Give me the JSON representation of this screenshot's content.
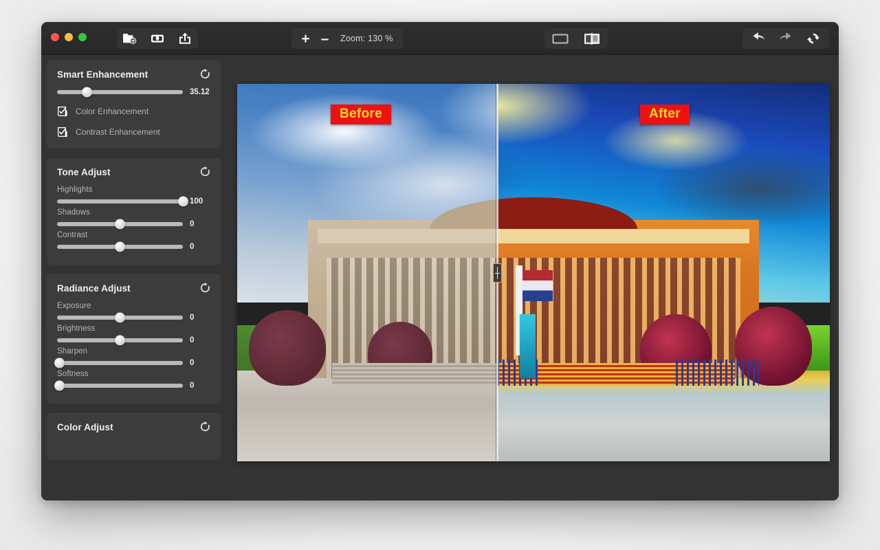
{
  "window": {
    "traffic_lights": [
      "close",
      "minimize",
      "zoom"
    ],
    "colors": {
      "close": "#fc5754",
      "minimize": "#fdbc40",
      "zoom": "#34c748",
      "accent": "#ee1111",
      "tag_text": "#ffdd22"
    }
  },
  "toolbar": {
    "open_label": "Open",
    "save_label": "Save",
    "share_label": "Share",
    "zoom_in_label": "+",
    "zoom_out_label": "–",
    "zoom_text": "Zoom: 130 %",
    "view_single_label": "Single View",
    "view_split_label": "Split View",
    "undo_label": "Undo",
    "redo_label": "Redo",
    "reset_label": "Reset All"
  },
  "sidebar": {
    "panels": [
      {
        "title": "Smart Enhancement",
        "reset_label": "Reset",
        "sliders": [
          {
            "label": "",
            "value": "35.12",
            "percent": 24
          }
        ],
        "checkboxes": [
          {
            "label": "Color Enhancement",
            "checked": true
          },
          {
            "label": "Contrast Enhancement",
            "checked": true
          }
        ]
      },
      {
        "title": "Tone Adjust",
        "reset_label": "Reset",
        "sliders": [
          {
            "label": "Highlights",
            "value": "100",
            "percent": 100
          },
          {
            "label": "Shadows",
            "value": "0",
            "percent": 50
          },
          {
            "label": "Contrast",
            "value": "0",
            "percent": 50
          }
        ],
        "checkboxes": []
      },
      {
        "title": "Radiance Adjust",
        "reset_label": "Reset",
        "sliders": [
          {
            "label": "Exposure",
            "value": "0",
            "percent": 50
          },
          {
            "label": "Brightness",
            "value": "0",
            "percent": 50
          },
          {
            "label": "Sharpen",
            "value": "0",
            "percent": 0
          },
          {
            "label": "Softness",
            "value": "0",
            "percent": 0
          }
        ],
        "checkboxes": []
      },
      {
        "title": "Color Adjust",
        "reset_label": "Reset",
        "sliders": [],
        "checkboxes": []
      }
    ]
  },
  "canvas": {
    "before_tag": "Before",
    "after_tag": "After",
    "split_percent": 43.7,
    "image_description": "Wide daytime photograph of a neoclassical museum building with a columned portico, a flagpole and statue in front, green lawns, red-leaved trees and a broad paved plaza; left half unedited, right half heavily color-enhanced."
  }
}
